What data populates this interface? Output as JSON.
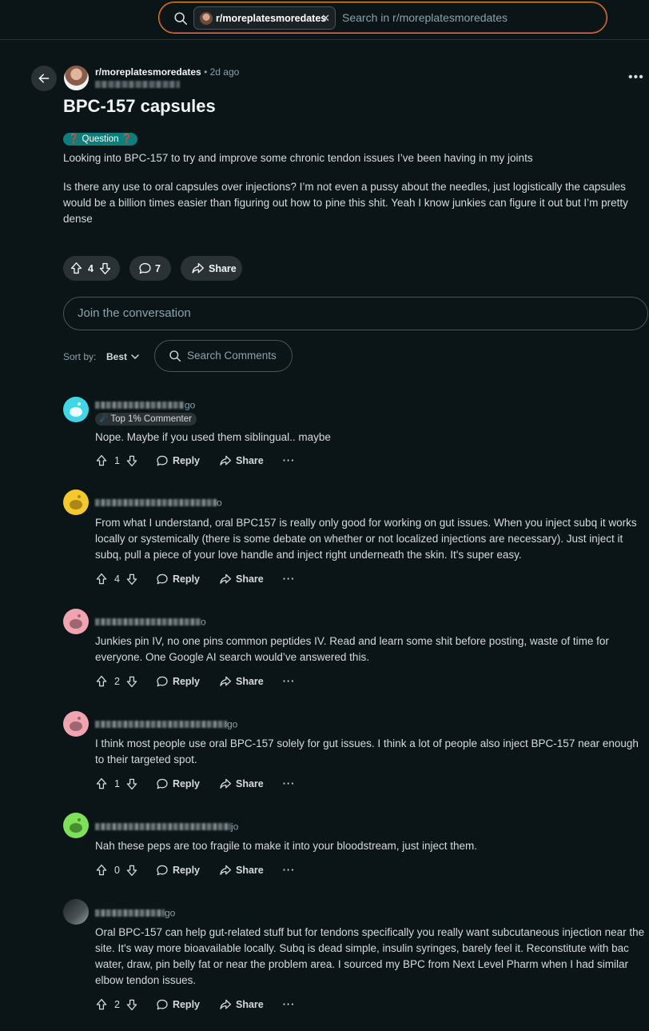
{
  "search": {
    "chip_label": "r/moreplatesmoredates",
    "chip_remove": "✕",
    "placeholder": "Search in r/moreplatesmoredates"
  },
  "post": {
    "subreddit": "r/moreplatesmoredates",
    "time": " • 2d ago",
    "title": "BPC-157 capsules",
    "flair": "Question",
    "flair_emoji": "❓",
    "body_p1": "Looking into BPC-157 to try and improve some chronic tendon issues I’ve been having in my joints",
    "body_p2": "Is there any use to oral capsules over injections? I’m not even a pussy about the needles, just logistically the capsules would be a billion times easier than figuring out how to pine this shit. Yeah I know junkies can figure it out but I’m pretty dense",
    "votes": "4",
    "comments": "7",
    "share_label": "Share",
    "more": "•••"
  },
  "composer": {
    "placeholder": "Join the conversation"
  },
  "sort": {
    "label": "Sort by:",
    "value": "Best"
  },
  "comment_search": {
    "placeholder": "Search Comments"
  },
  "comments": [
    {
      "ago": "go",
      "badge": "Top 1% Commenter",
      "text": "Nope. Maybe if you used them siblingual.. maybe",
      "votes": "1",
      "reply": "Reply",
      "share": "Share",
      "more": "···"
    },
    {
      "ago": "o",
      "text": "From what I understand, oral BPC157 is really only good for working on gut issues. When you inject subq it works locally or systemically (there is some debate on whether or not localized injections are necessary). Just inject it subq, pull a piece of your love handle and inject right underneath the skin. It's super easy.",
      "votes": "4",
      "reply": "Reply",
      "share": "Share",
      "more": "···"
    },
    {
      "ago": "o",
      "text": "Junkies pin IV, no one pins common peptides IV. Read and learn some shit before posting, waste of time for everyone. One Google AI search would’ve answered this.",
      "votes": "2",
      "reply": "Reply",
      "share": "Share",
      "more": "···"
    },
    {
      "ago": "go",
      "text": "I think most people use oral BPC-157 solely for gut issues. I think a lot of people also inject BPC-157 near enough to their targeted spot.",
      "votes": "1",
      "reply": "Reply",
      "share": "Share",
      "more": "···"
    },
    {
      "ago": "jo",
      "text": "Nah these peps are too fragile to make it into your bloodstream, just inject them.",
      "votes": "0",
      "reply": "Reply",
      "share": "Share",
      "more": "···"
    },
    {
      "ago": "go",
      "text": "Oral BPC-157 can help gut-related stuff but for tendons specifically you really want subcutaneous injection near the site. It's way more bioavailable locally. Subq is dead simple, insulin syringes, barely feel it. Reconstitute with bac water, draw, pin belly fat or near the problem area. I sourced my BPC from Next Level Pharm when I had similar elbow tendon issues.",
      "votes": "2",
      "reply": "Reply",
      "share": "Share",
      "more": "···"
    }
  ],
  "colors": {
    "background": "#0b1416",
    "pill": "#2a3236",
    "flair": "#0d7e7a",
    "search_border": "#e8902c",
    "muted_text": "#8ba2ad"
  }
}
